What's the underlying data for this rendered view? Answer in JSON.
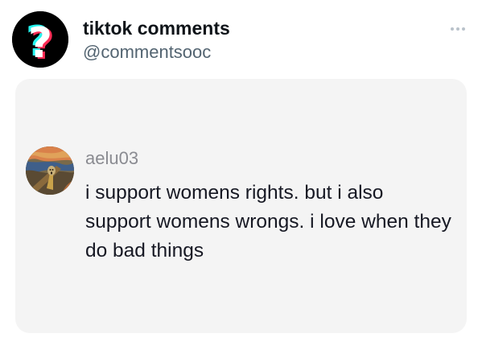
{
  "post": {
    "account_name": "tiktok comments",
    "account_handle": "@commentsooc",
    "avatar_icon": "question-mark-icon",
    "more_icon": "more-horizontal-icon"
  },
  "comment": {
    "username": "aelu03",
    "text": "i support womens rights. but i also support womens wrongs. i love when they do bad things",
    "avatar_icon": "the-scream-painting-avatar"
  },
  "colors": {
    "card_background": "#f4f4f4",
    "username_gray": "#8a8b91",
    "handle_gray": "#536471",
    "tiktok_cyan": "#25f4ee",
    "tiktok_red": "#fe2c55"
  }
}
